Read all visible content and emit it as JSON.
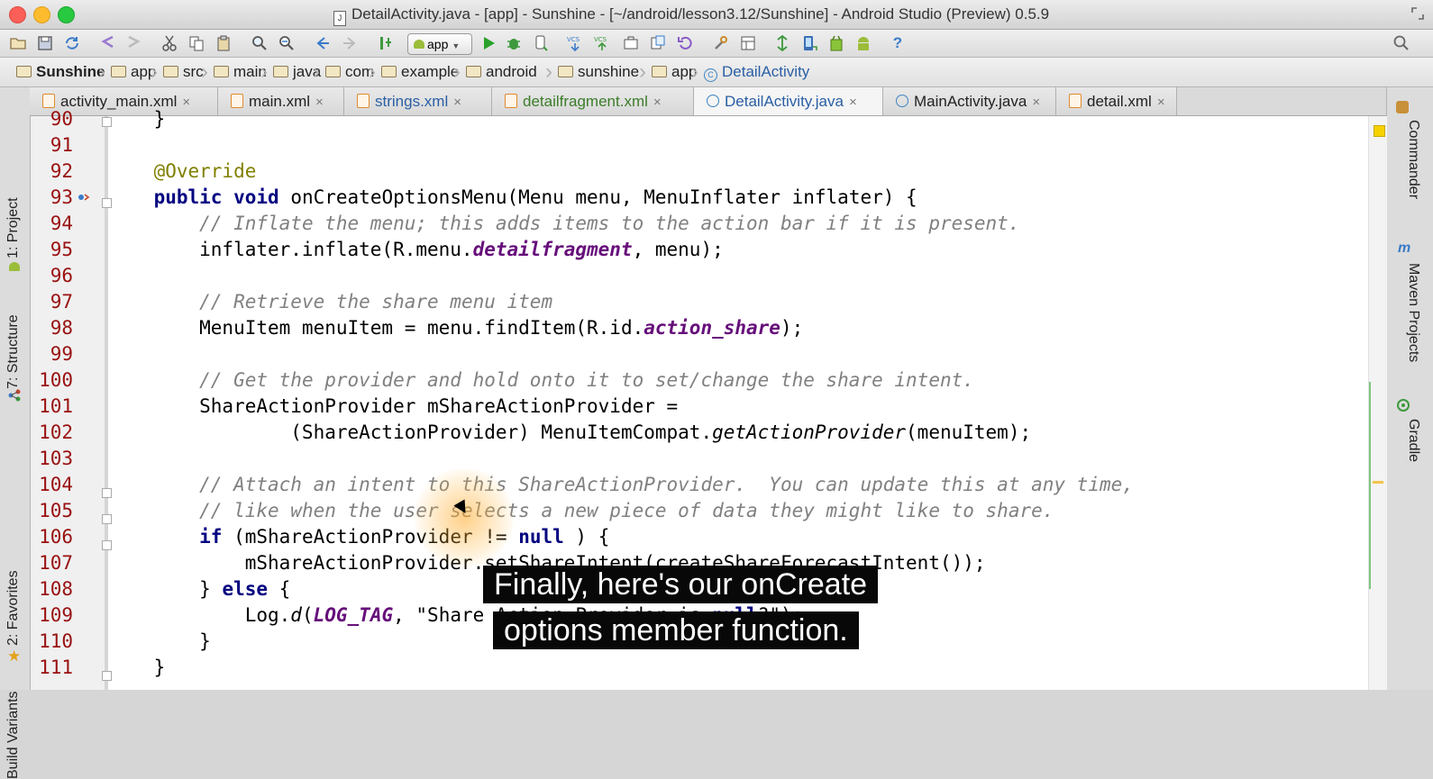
{
  "window": {
    "title": "DetailActivity.java - [app] - Sunshine - [~/android/lesson3.12/Sunshine] - Android Studio (Preview) 0.5.9",
    "doc_icon_glyph": "J"
  },
  "toolbar": {
    "run_config_label": "app",
    "help_glyph": "?"
  },
  "breadcrumbs": [
    "Sunshine",
    "app",
    "src",
    "main",
    "java",
    "com",
    "example",
    "android",
    "sunshine",
    "app",
    "DetailActivity"
  ],
  "tabs": [
    {
      "label": "activity_main.xml",
      "active": false,
      "kind": "xml"
    },
    {
      "label": "main.xml",
      "active": false,
      "kind": "xml"
    },
    {
      "label": "strings.xml",
      "active": false,
      "kind": "xml"
    },
    {
      "label": "detailfragment.xml",
      "active": false,
      "kind": "xml"
    },
    {
      "label": "DetailActivity.java",
      "active": true,
      "kind": "class"
    },
    {
      "label": "MainActivity.java",
      "active": false,
      "kind": "class"
    },
    {
      "label": "detail.xml",
      "active": false,
      "kind": "xml"
    }
  ],
  "tab_close_glyph": "×",
  "left_tools": [
    "1: Project",
    "7: Structure",
    "2: Favorites",
    "Build Variants"
  ],
  "right_tools": [
    "Commander",
    "Maven Projects",
    "Gradle"
  ],
  "code": {
    "lines": [
      {
        "n": "90",
        "text": "    }"
      },
      {
        "n": "91",
        "text": ""
      },
      {
        "n": "92",
        "text": "    @Override"
      },
      {
        "n": "93",
        "text": "    public void onCreateOptionsMenu(Menu menu, MenuInflater inflater) {"
      },
      {
        "n": "94",
        "text": "        // Inflate the menu; this adds items to the action bar if it is present."
      },
      {
        "n": "95",
        "text": "        inflater.inflate(R.menu.detailfragment, menu);"
      },
      {
        "n": "96",
        "text": ""
      },
      {
        "n": "97",
        "text": "        // Retrieve the share menu item"
      },
      {
        "n": "98",
        "text": "        MenuItem menuItem = menu.findItem(R.id.action_share);"
      },
      {
        "n": "99",
        "text": ""
      },
      {
        "n": "100",
        "text": "        // Get the provider and hold onto it to set/change the share intent."
      },
      {
        "n": "101",
        "text": "        ShareActionProvider mShareActionProvider ="
      },
      {
        "n": "102",
        "text": "                (ShareActionProvider) MenuItemCompat.getActionProvider(menuItem);"
      },
      {
        "n": "103",
        "text": ""
      },
      {
        "n": "104",
        "text": "        // Attach an intent to this ShareActionProvider.  You can update this at any time,"
      },
      {
        "n": "105",
        "text": "        // like when the user selects a new piece of data they might like to share."
      },
      {
        "n": "106",
        "text": "        if (mShareActionProvider != null ) {"
      },
      {
        "n": "107",
        "text": "            mShareActionProvider.setShareIntent(createShareForecastIntent());"
      },
      {
        "n": "108",
        "text": "        } else {"
      },
      {
        "n": "109",
        "text": "            Log.d(LOG_TAG, \"Share Action Provider is null?\");"
      },
      {
        "n": "110",
        "text": "        }"
      },
      {
        "n": "111",
        "text": "    }"
      }
    ]
  },
  "subtitle": {
    "line1": "Finally, here's our onCreate",
    "line2": "options member function."
  },
  "colors": {
    "keyword": "#000080",
    "comment": "#808080",
    "annotation": "#808000",
    "field": "#660e7a",
    "line_number": "#991010"
  }
}
